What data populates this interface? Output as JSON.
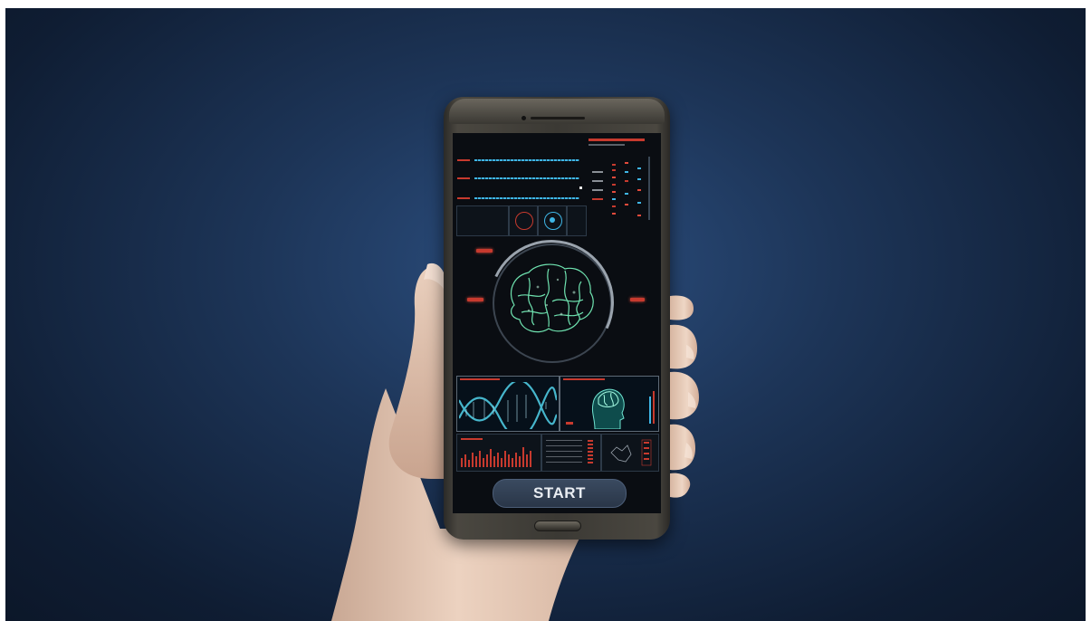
{
  "app": {
    "title": "",
    "start_label": "START"
  },
  "colors": {
    "accent_red": "#e24a3b",
    "accent_cyan": "#3fb6e6",
    "brain_green": "#6fe3b0",
    "background": "#1d3558"
  },
  "icons": {
    "brain": "brain-icon",
    "dna": "dna-helix-icon",
    "head_scan": "head-scan-icon"
  }
}
